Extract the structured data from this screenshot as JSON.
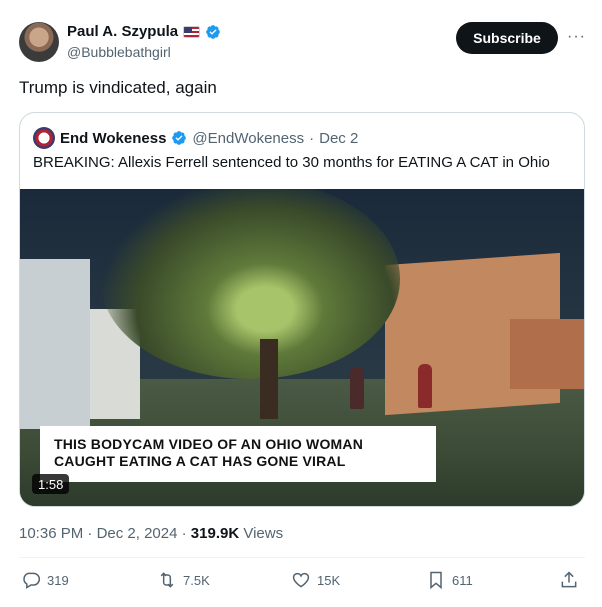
{
  "author": {
    "name": "Paul A. Szypula",
    "handle": "@Bubblebathgirl"
  },
  "header": {
    "subscribe_label": "Subscribe",
    "more_label": "···"
  },
  "tweet": {
    "text": "Trump is vindicated, again"
  },
  "quote": {
    "name": "End Wokeness",
    "handle": "@EndWokeness",
    "date": "Dec 2",
    "text": "BREAKING: Allexis Ferrell sentenced to 30 months for EATING A CAT in Ohio",
    "video": {
      "caption_line1": "THIS BODYCAM VIDEO OF AN OHIO WOMAN",
      "caption_line2": "CAUGHT EATING A CAT HAS GONE VIRAL",
      "duration": "1:58"
    }
  },
  "meta": {
    "time": "10:36 PM",
    "date": "Dec 2, 2024",
    "views_count": "319.9K",
    "views_label": "Views"
  },
  "actions": {
    "replies": "319",
    "reposts": "7.5K",
    "likes": "15K",
    "bookmarks": "611"
  },
  "colors": {
    "verified": "#1d9bf0",
    "muted": "#536471",
    "button_bg": "#0f1419"
  }
}
